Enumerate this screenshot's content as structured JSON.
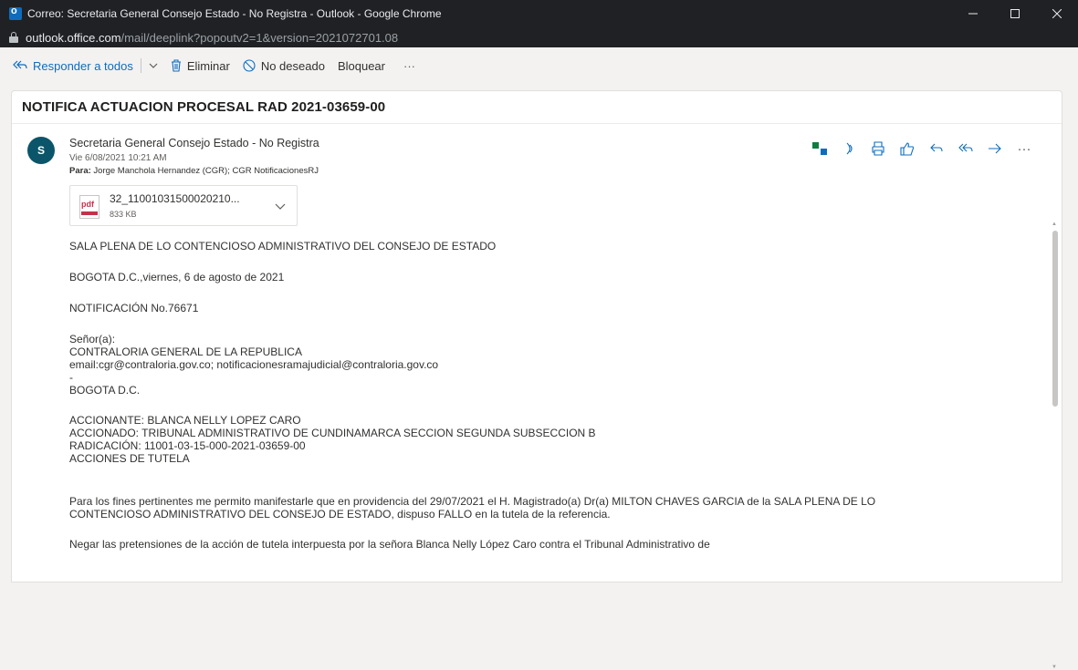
{
  "window": {
    "title": "Correo: Secretaria General Consejo Estado - No Registra - Outlook - Google Chrome",
    "url_host": "outlook.office.com",
    "url_path": "/mail/deeplink?popoutv2=1&version=2021072701.08"
  },
  "toolbar": {
    "reply_all": "Responder a todos",
    "delete": "Eliminar",
    "junk": "No deseado",
    "block": "Bloquear",
    "more": "···"
  },
  "message": {
    "subject": "NOTIFICA ACTUACION PROCESAL RAD 2021-03659-00",
    "avatar_initial": "S",
    "sender": "Secretaria General Consejo Estado - No Registra",
    "date": "Vie 6/08/2021 10:21 AM",
    "to_label": "Para:",
    "to_value": "Jorge Manchola Hernandez (CGR); CGR NotificacionesRJ",
    "attachment": {
      "name": "32_11001031500020210...",
      "size": "833 KB",
      "icon_label": "pdf"
    },
    "body": {
      "l1": "SALA PLENA DE LO CONTENCIOSO ADMINISTRATIVO DEL CONSEJO DE ESTADO",
      "l2": "BOGOTA D.C.,viernes, 6 de agosto de 2021",
      "l3": "NOTIFICACIÓN No.76671",
      "l4": "Señor(a):",
      "l5": "CONTRALORIA GENERAL DE LA REPUBLICA",
      "l6": "email:cgr@contraloria.gov.co; notificacionesramajudicial@contraloria.gov.co",
      "l7": "-",
      "l8": "BOGOTA D.C.",
      "l9": "ACCIONANTE: BLANCA NELLY LOPEZ CARO",
      "l10": "ACCIONADO: TRIBUNAL ADMINISTRATIVO DE CUNDINAMARCA SECCION SEGUNDA SUBSECCION B",
      "l11": "RADICACIÓN: 11001-03-15-000-2021-03659-00",
      "l12": "ACCIONES DE TUTELA",
      "p1a": "Para los fines pertinentes me permito manifestarle que en providencia del 29/07/2021  el H. Magistrado(a) Dr(a) MILTON CHAVES GARCIA de la SALA PLENA DE LO",
      "p1b": "CONTENCIOSO ADMINISTRATIVO DEL CONSEJO DE ESTADO, dispuso FALLO en la tutela de la referencia.",
      "p2": "Negar las pretensiones de la acción de tutela interpuesta por la señora Blanca Nelly López Caro contra el Tribunal Administrativo de"
    }
  },
  "colors": {
    "accent": "#0f6cbd",
    "avatar_bg": "#0b556a",
    "titlebar_bg": "#202124"
  }
}
